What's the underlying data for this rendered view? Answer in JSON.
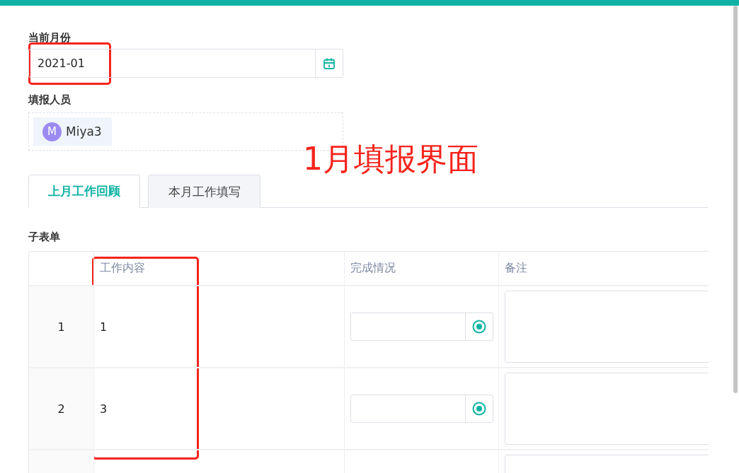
{
  "month_field": {
    "label": "当前月份",
    "value": "2021-01"
  },
  "reporter_field": {
    "label": "填报人员",
    "members": [
      {
        "initial": "M",
        "name": "Miya3",
        "color": "#9b8af0"
      }
    ]
  },
  "tabs": [
    {
      "label": "上月工作回顾",
      "selected": true
    },
    {
      "label": "本月工作填写",
      "selected": false
    }
  ],
  "subform": {
    "title": "子表单",
    "columns": [
      "工作内容",
      "完成情况",
      "备注"
    ],
    "rows": [
      {
        "index": "1",
        "content": "1"
      },
      {
        "index": "2",
        "content": "3"
      },
      {}
    ]
  },
  "annotation": {
    "text": "1月填报界面"
  }
}
